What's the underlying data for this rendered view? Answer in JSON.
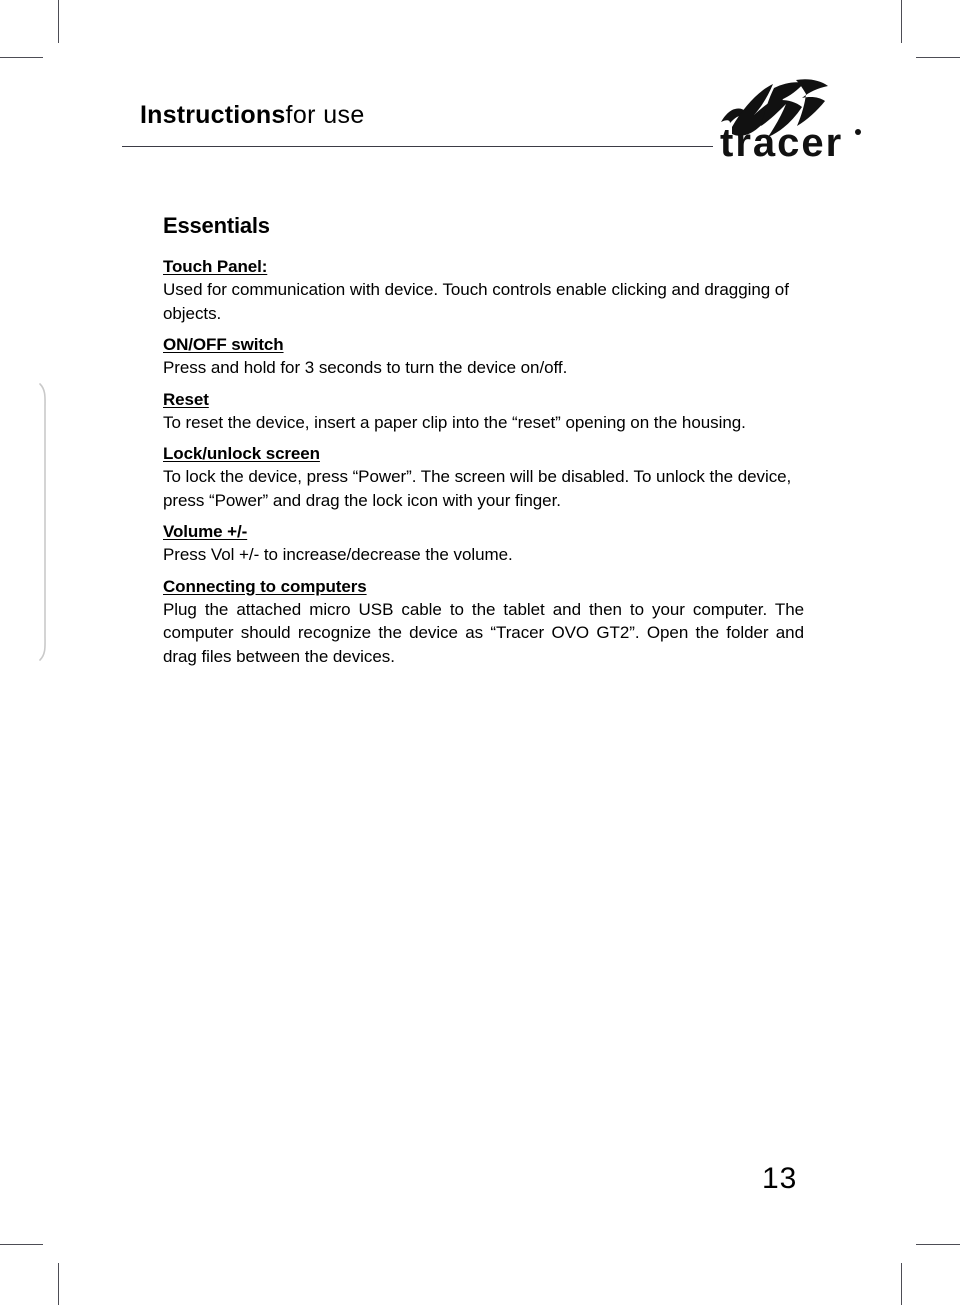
{
  "header": {
    "title_bold": "Instructions",
    "title_light": "for use",
    "logo_wordmark": "tracer",
    "logo_trademark": "®",
    "logo_mark_name": "tracer-mountain-arrow-mark"
  },
  "page": {
    "number": "13"
  },
  "content": {
    "section_title": "Essentials",
    "blocks": [
      {
        "heading": "Touch Panel:",
        "text": "Used for communication with device. Touch controls enable clicking and dragging of objects.",
        "justified": false
      },
      {
        "heading": "ON/OFF switch",
        "text": "Press and hold for 3 seconds to turn the device on/off.",
        "justified": false
      },
      {
        "heading": "Reset",
        "text": "To reset the device, insert a paper clip into the “reset” opening on the housing.",
        "justified": true
      },
      {
        "heading": "Lock/unlock screen",
        "text": "To lock the device, press “Power”. The screen will be disabled. To unlock the device, press “Power” and drag the lock icon with your finger.",
        "justified": false
      },
      {
        "heading": "Volume +/-",
        "text": "Press Vol +/- to increase/decrease the volume.",
        "justified": false
      },
      {
        "heading": "Connecting to computers",
        "text": "Plug the attached micro USB cable to the tablet and then to your computer. The computer should recognize the device as “Tracer OVO GT2”. Open the folder and drag files between the devices.",
        "justified": true
      }
    ]
  },
  "colors": {
    "ink": "#000000",
    "rule": "#3b3b45",
    "crop_mark": "#4d4d55",
    "spine": "#c9c9c9",
    "paper": "#ffffff"
  }
}
